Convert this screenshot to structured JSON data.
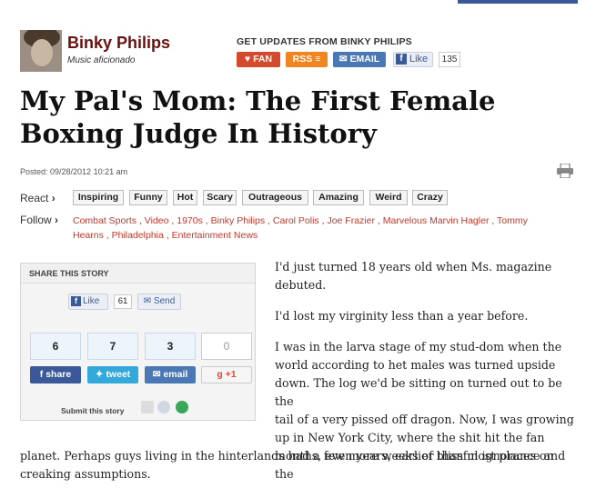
{
  "author": {
    "name": "Binky Philips",
    "subtitle": "Music aficionado"
  },
  "updates": {
    "title": "GET UPDATES FROM BINKY PHILIPS",
    "fan_label": "FAN",
    "rss_label": "RSS",
    "email_label": "EMAIL",
    "like_label": "Like",
    "like_count": "135"
  },
  "headline": {
    "line1": "My Pal's Mom: The First Female",
    "line2": "Boxing Judge In History"
  },
  "posted": "Posted: 09/28/2012 10:21 am",
  "react": {
    "label": "React",
    "tags": [
      "Inspiring",
      "Funny",
      "Hot",
      "Scary",
      "Outrageous",
      "Amazing",
      "Weird",
      "Crazy"
    ]
  },
  "follow": {
    "label": "Follow",
    "links": [
      "Combat Sports",
      "Video",
      "1970s",
      "Binky Philips",
      "Carol Polis",
      "Joe Frazier",
      "Marvelous Marvin Hagler",
      "Tommy Hearns",
      "Philadelphia",
      "Entertainment News"
    ]
  },
  "share": {
    "title": "SHARE THIS STORY",
    "like_label": "Like",
    "like_count": "61",
    "send_label": "Send",
    "counts": [
      "6",
      "7",
      "3",
      "0"
    ],
    "buttons": {
      "facebook": "share",
      "twitter": "tweet",
      "email": "email",
      "gplus": "+1"
    },
    "submit_label": "Submit this story"
  },
  "article": {
    "p1": "I'd just turned 18 years old when Ms. magazine debuted.",
    "p2": "I'd lost my virginity less than a year before.",
    "p3_lines": [
      "I was in the larva stage of my stud-dom when the",
      "world according to het males was turned upside",
      "down. The log we'd be sitting on turned out to be the",
      "tail of a very pissed off dragon. Now, I was growing",
      "up in New York City, where the shit hit the fan",
      "months, even years, earlier than most places on the"
    ],
    "p3_wide_lines": [
      "planet. Perhaps guys living in the hinterlands had a few more weeks of blissful ignorance and",
      "creaking assumptions."
    ]
  },
  "colors": {
    "author": "#6b0f0f",
    "link": "#c0392b",
    "facebook": "#3b5998",
    "twitter": "#33a8db",
    "fan": "#d44a2c",
    "rss": "#f0841f"
  }
}
